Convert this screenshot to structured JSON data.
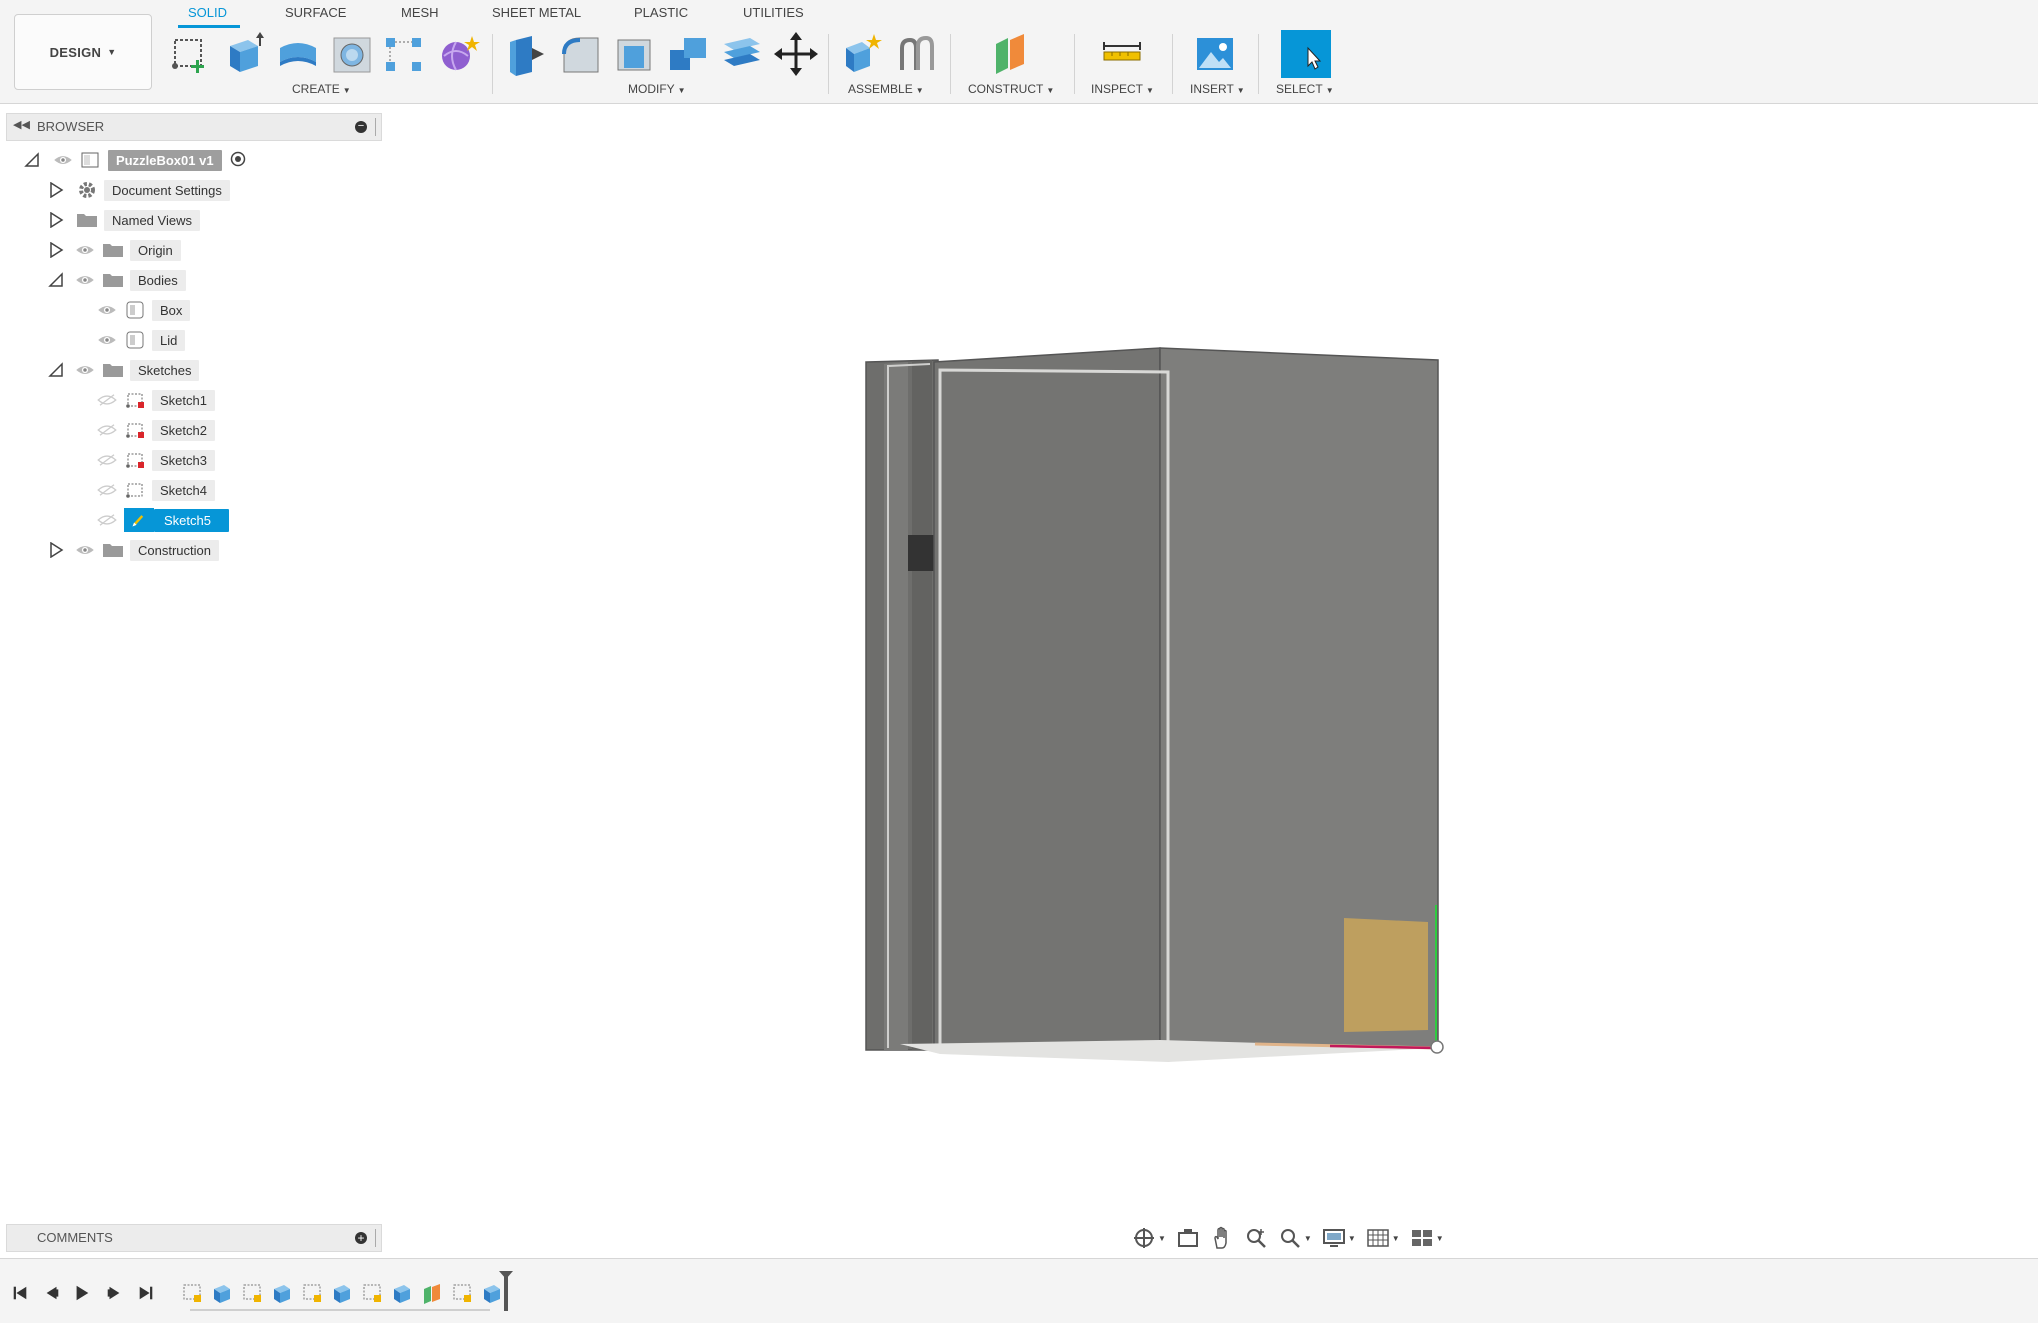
{
  "workspace": {
    "label": "DESIGN"
  },
  "tabs": [
    {
      "label": "SOLID",
      "active": true
    },
    {
      "label": "SURFACE"
    },
    {
      "label": "MESH"
    },
    {
      "label": "SHEET METAL"
    },
    {
      "label": "PLASTIC"
    },
    {
      "label": "UTILITIES"
    }
  ],
  "groups": {
    "create": "CREATE",
    "modify": "MODIFY",
    "assemble": "ASSEMBLE",
    "construct": "CONSTRUCT",
    "inspect": "INSPECT",
    "insert": "INSERT",
    "select": "SELECT"
  },
  "browser": {
    "title": "BROWSER",
    "root": "PuzzleBox01 v1",
    "document_settings": "Document Settings",
    "named_views": "Named Views",
    "origin": "Origin",
    "bodies": "Bodies",
    "bodies_items": [
      "Box",
      "Lid"
    ],
    "sketches": "Sketches",
    "sketch_items": [
      "Sketch1",
      "Sketch2",
      "Sketch3",
      "Sketch4",
      "Sketch5"
    ],
    "selected_sketch": "Sketch5",
    "construction": "Construction"
  },
  "comments": {
    "title": "COMMENTS"
  },
  "colors": {
    "accent": "#0696d7",
    "body_gray": "#7a7a78",
    "sketch_profile": "#c9a55a"
  }
}
